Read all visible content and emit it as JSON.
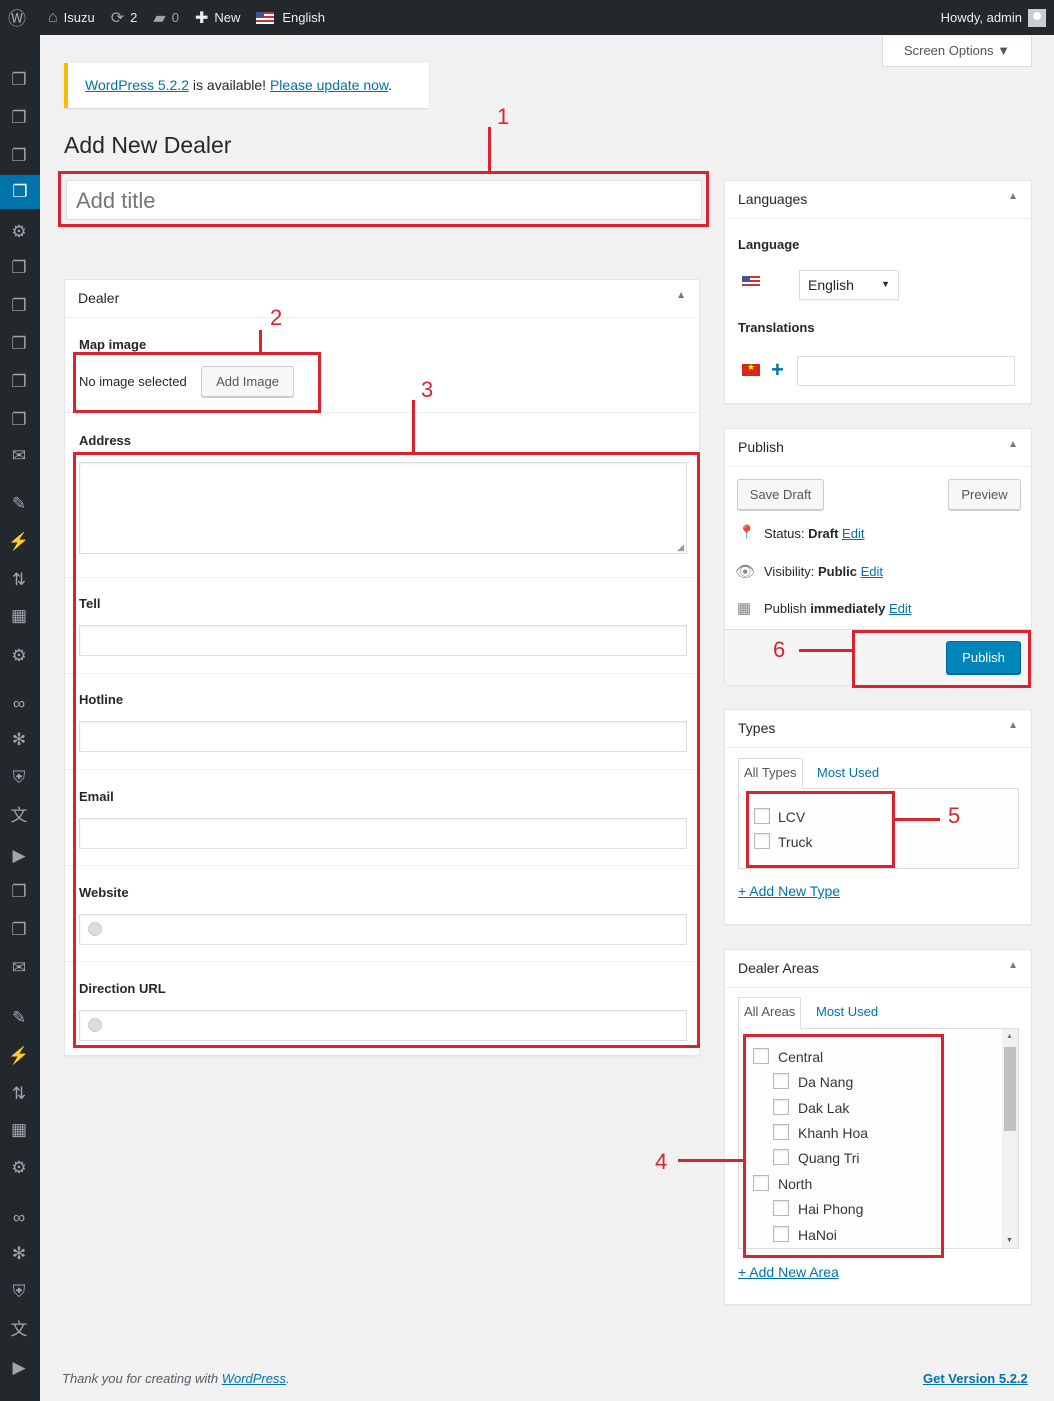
{
  "adminbar": {
    "site_name": "Isuzu",
    "updates_count": "2",
    "comments_count": "0",
    "new_label": "New",
    "language": "English",
    "howdy": "Howdy, admin"
  },
  "notice": {
    "version_link": "WordPress 5.2.2",
    "text": " is available! ",
    "update_link": "Please update now",
    "period": "."
  },
  "screen_options": "Screen Options ▼",
  "page_title": "Add New Dealer",
  "title_placeholder": "Add title",
  "dealer_box": {
    "title": "Dealer",
    "map_image_label": "Map image",
    "no_image_text": "No image selected",
    "add_image_button": "Add Image",
    "address_label": "Address",
    "tell_label": "Tell",
    "hotline_label": "Hotline",
    "email_label": "Email",
    "website_label": "Website",
    "direction_label": "Direction URL"
  },
  "languages_box": {
    "title": "Languages",
    "language_label": "Language",
    "language_value": "English",
    "translations_label": "Translations"
  },
  "publish_box": {
    "title": "Publish",
    "save_draft": "Save Draft",
    "preview": "Preview",
    "status_label": "Status: ",
    "status_value": "Draft",
    "visibility_label": "Visibility: ",
    "visibility_value": "Public",
    "publish_label": "Publish ",
    "publish_value": "immediately",
    "edit": "Edit",
    "publish_button": "Publish"
  },
  "types_box": {
    "title": "Types",
    "tab_all": "All Types",
    "tab_most": "Most Used",
    "items": [
      "LCV",
      "Truck"
    ],
    "add_new": "+ Add New Type"
  },
  "areas_box": {
    "title": "Dealer Areas",
    "tab_all": "All Areas",
    "tab_most": "Most Used",
    "items": [
      {
        "label": "Central",
        "child": false
      },
      {
        "label": "Da Nang",
        "child": true
      },
      {
        "label": "Dak Lak",
        "child": true
      },
      {
        "label": "Khanh Hoa",
        "child": true
      },
      {
        "label": "Quang Tri",
        "child": true
      },
      {
        "label": "North",
        "child": false
      },
      {
        "label": "Hai Phong",
        "child": true
      },
      {
        "label": "HaNoi",
        "child": true
      }
    ],
    "add_new": "+ Add New Area"
  },
  "annotations": [
    "1",
    "2",
    "3",
    "4",
    "5",
    "6"
  ],
  "footer": {
    "thanks": "Thank you for creating with ",
    "wp_link": "WordPress",
    "period": ".",
    "version": "Get Version 5.2.2"
  },
  "colors": {
    "accent": "#0073aa",
    "annotation": "#d9232e",
    "notice_border": "#ffb900"
  }
}
